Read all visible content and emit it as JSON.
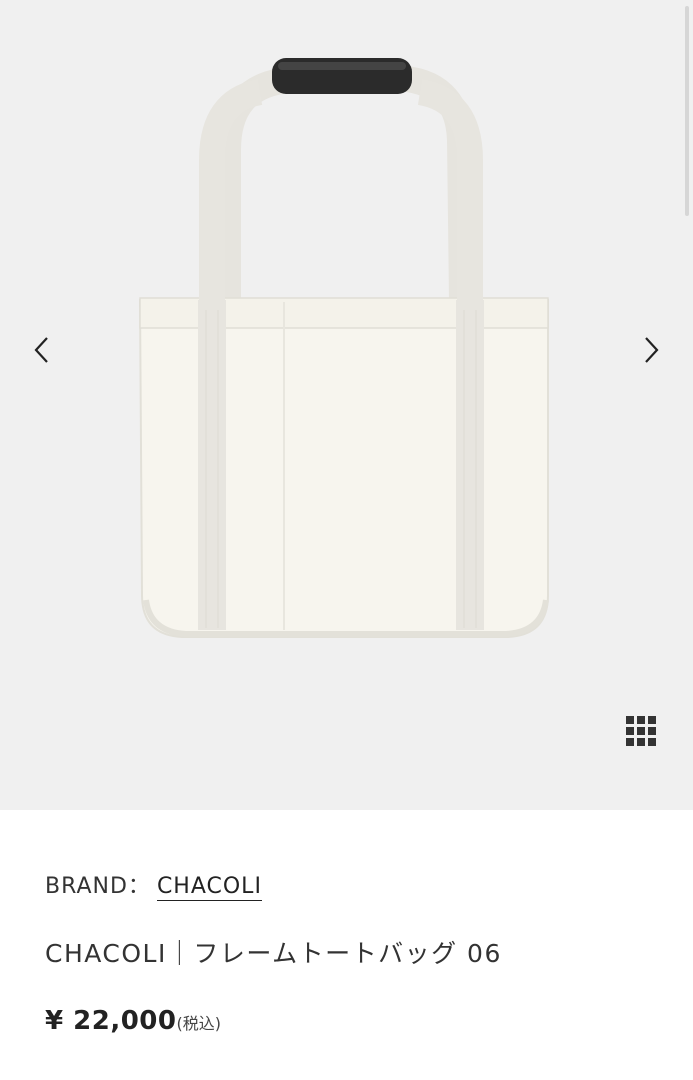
{
  "gallery": {
    "image_alt": "CHACOLI tote bag product image",
    "prev_icon": "chevron-left-icon",
    "next_icon": "chevron-right-icon",
    "grid_icon": "grid-icon"
  },
  "product": {
    "brand_label": "BRAND：",
    "brand_name": "CHACOLI",
    "title": "CHACOLI｜フレームトートバッグ 06",
    "price": "¥ 22,000",
    "tax_note": "(税込)"
  },
  "colors": {
    "gallery_bg": "#f0f0f0",
    "bag_body": "#f7f5ee",
    "handle_grip": "#2b2b2b"
  }
}
